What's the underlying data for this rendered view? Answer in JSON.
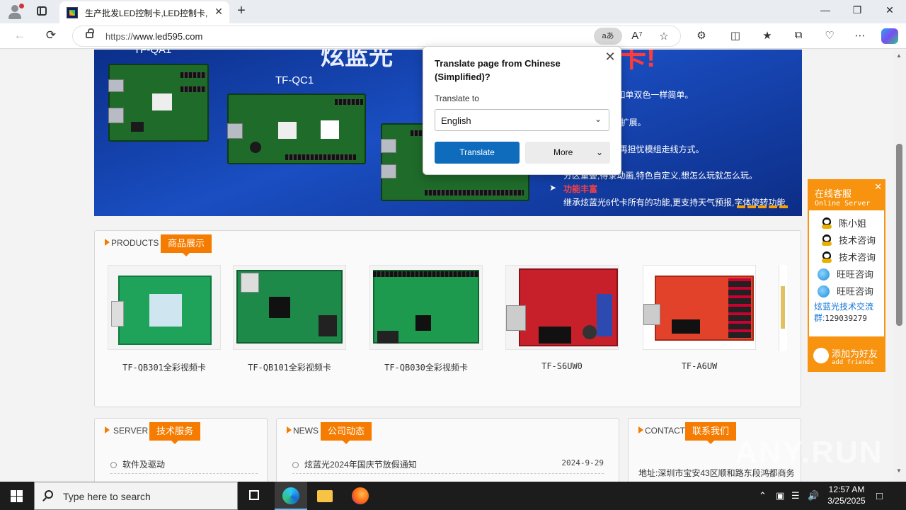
{
  "browser": {
    "tab_title": "生产批发LED控制卡,LED控制卡,G",
    "url_scheme": "https://",
    "url_host": "www.led595.com",
    "translate_pill": "aあ",
    "new_tab": "+",
    "tab_close": "✕"
  },
  "translate_popup": {
    "title": "Translate page from Chinese (Simplified)?",
    "translate_to_label": "Translate to",
    "language": "English",
    "translate_button": "Translate",
    "more_button": "More"
  },
  "banner": {
    "title_fragment": "炫蓝光",
    "title_fragment_red": "卡!",
    "board_label_1": "TF-QA1",
    "board_label_2": "TF-QC1",
    "features": [
      "合一,让全彩犹如单双色一样简单。",
      "更支持U盘无限扩展。",
      "用;智能设置,不再担忧模组走线方式。",
      "分区重叠,得录动画,特色自定义,想怎么玩就怎么玩。"
    ],
    "feature_heading": "功能丰富",
    "feature_last": "继承炫蓝光6代卡所有的功能,更支持天气预报,字体旋转功能"
  },
  "products": {
    "section_en": "PRODUCTS",
    "section_cn": "商品展示",
    "items": [
      {
        "name": "TF-QB301全彩视频卡"
      },
      {
        "name": "TF-QB101全彩视频卡"
      },
      {
        "name": "TF-QB030全彩视频卡"
      },
      {
        "name": "TF-S6UW0"
      },
      {
        "name": "TF-A6UW"
      }
    ]
  },
  "server": {
    "section_en": "SERVER",
    "section_cn": "技术服务",
    "items": [
      "软件及驱动"
    ]
  },
  "news": {
    "section_en": "NEWS",
    "section_cn": "公司动态",
    "items": [
      {
        "title": "炫蓝光2024年国庆节放假通知",
        "date": "2024-9-29"
      }
    ]
  },
  "contact": {
    "section_en": "CONTACT",
    "section_cn": "联系我们",
    "address": "地址:深圳市宝安43区顺和路东段鸿都商务"
  },
  "online_service": {
    "title_cn": "在线客服",
    "title_en": "Online Server",
    "close": "✕",
    "contacts": [
      {
        "name": "陈小姐",
        "icon": "qq-icon"
      },
      {
        "name": "技术咨询",
        "icon": "qq-icon"
      },
      {
        "name": "技术咨询",
        "icon": "qq-icon"
      },
      {
        "name": "旺旺咨询",
        "icon": "wangwang-icon"
      },
      {
        "name": "旺旺咨询",
        "icon": "wangwang-icon"
      }
    ],
    "group_label": "炫蓝光技术交流群:",
    "group_number": "129039279",
    "add_friends_cn": "添加为好友",
    "add_friends_en": "add friends"
  },
  "watermark": "ANY.RUN",
  "taskbar": {
    "search_placeholder": "Type here to search",
    "time": "12:57 AM",
    "date": "3/25/2025"
  },
  "colors": {
    "accent_orange": "#f57c00",
    "edge_blue": "#0f6cbd",
    "banner_blue": "#1a4ec2"
  }
}
